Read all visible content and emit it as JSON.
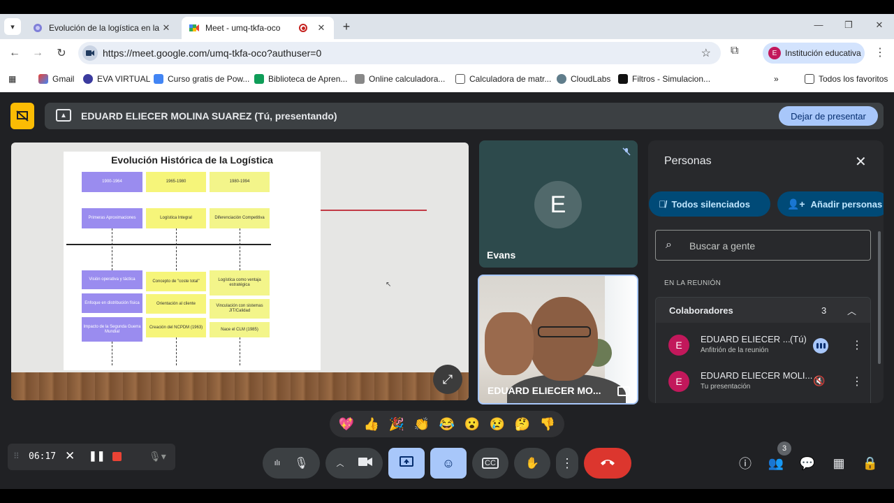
{
  "browser": {
    "tabs": [
      {
        "title": "Evolución de la logística en la e",
        "active": false
      },
      {
        "title": "Meet - umq-tkfa-oco",
        "active": true
      }
    ],
    "url": "https://meet.google.com/umq-tkfa-oco?authuser=0",
    "profile_label": "Institución educativa",
    "profile_initial": "E",
    "bookmarks": [
      "Gmail",
      "EVA VIRTUAL",
      "Curso gratis de Pow...",
      "Biblioteca de Apren...",
      "Online calculadora...",
      "Calculadora de matr...",
      "CloudLabs",
      "Filtros - Simulacion..."
    ],
    "all_bookmarks_label": "Todos los favoritos"
  },
  "meet": {
    "presenting_banner": "EDUARD ELIECER MOLINA SUAREZ (Tú, presentando)",
    "stop_presenting_label": "Dejar de presentar",
    "slide": {
      "title": "Evolución Histórica de la Logística",
      "periods": [
        "1900-1964",
        "1965-1980",
        "1980-1994"
      ],
      "phases": [
        "Primeras Aproximaciones",
        "Logística Integral",
        "Diferenciación Competitiva"
      ],
      "col1": [
        "Visión operativa y táctica",
        "Enfoque en distribución física",
        "Impacto de la Segunda Guerra Mundial"
      ],
      "col2": [
        "Concepto de \"coste total\"",
        "Orientación al cliente",
        "Creación del NCPDM (1963)"
      ],
      "col3": [
        "Logística como ventaja estratégica",
        "Vinculación con sistemas JIT/Calidad",
        "Nace el CLM (1985)"
      ]
    },
    "tiles": [
      {
        "name": "Evans",
        "initial": "E"
      },
      {
        "name": "EDUARD ELIECER MO..."
      }
    ],
    "people_panel": {
      "title": "Personas",
      "mute_all_label": "Todos silenciados",
      "add_people_label": "Añadir personas",
      "search_placeholder": "Buscar a gente",
      "section_label": "EN LA REUNIÓN",
      "group_label": "Colaboradores",
      "group_count": "3",
      "participants": [
        {
          "initial": "E",
          "name": "EDUARD ELIECER ...",
          "you": "(Tú)",
          "role": "Anfitrión de la reunión"
        },
        {
          "initial": "E",
          "name": "EDUARD ELIECER MOLI...",
          "role": "Tu presentación"
        }
      ]
    },
    "reactions": [
      "💖",
      "👍",
      "🎉",
      "👏",
      "😂",
      "😮",
      "😢",
      "🤔",
      "👎"
    ],
    "recorder": {
      "time": "06:17"
    },
    "people_count": "3"
  }
}
